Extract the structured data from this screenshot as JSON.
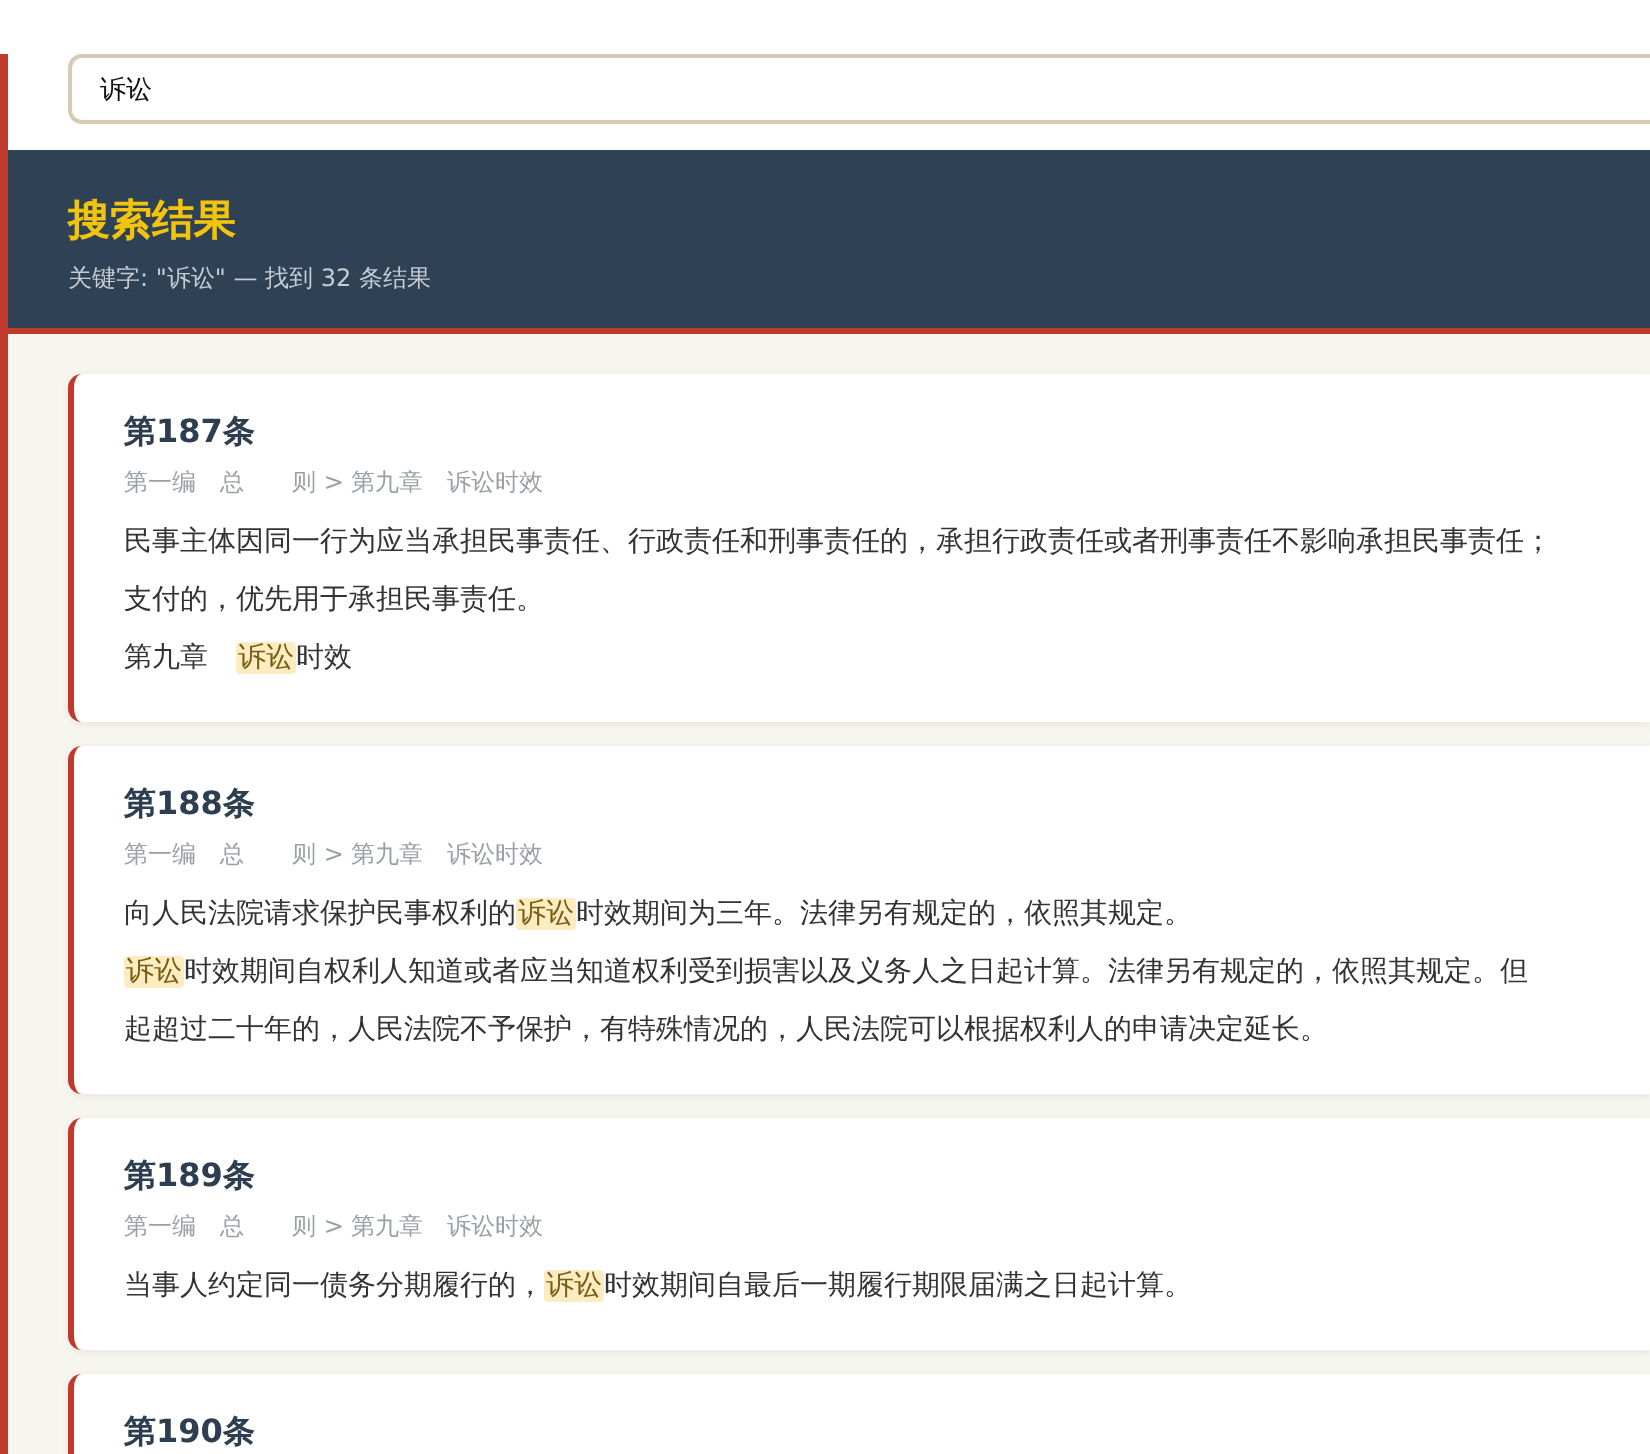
{
  "search": {
    "value": "诉讼"
  },
  "header": {
    "title": "搜索结果",
    "summary": "关键字: \"诉讼\" — 找到 32 条结果"
  },
  "results": [
    {
      "title": "第187条",
      "breadcrumb": "第一编　总　　则 > 第九章　诉讼时效",
      "lines": [
        [
          {
            "text": "民事主体因同一行为应当承担民事责任、行政责任和刑事责任的，承担行政责任或者刑事责任不影响承担民事责任；",
            "highlight": false
          }
        ],
        [
          {
            "text": "支付的，优先用于承担民事责任。",
            "highlight": false
          }
        ],
        [
          {
            "text": "第九章　",
            "highlight": false
          },
          {
            "text": "诉讼",
            "highlight": true
          },
          {
            "text": "时效",
            "highlight": false
          }
        ]
      ]
    },
    {
      "title": "第188条",
      "breadcrumb": "第一编　总　　则 > 第九章　诉讼时效",
      "lines": [
        [
          {
            "text": "向人民法院请求保护民事权利的",
            "highlight": false
          },
          {
            "text": "诉讼",
            "highlight": true
          },
          {
            "text": "时效期间为三年。法律另有规定的，依照其规定。",
            "highlight": false
          }
        ],
        [
          {
            "text": "诉讼",
            "highlight": true
          },
          {
            "text": "时效期间自权利人知道或者应当知道权利受到损害以及义务人之日起计算。法律另有规定的，依照其规定。但",
            "highlight": false
          }
        ],
        [
          {
            "text": "起超过二十年的，人民法院不予保护，有特殊情况的，人民法院可以根据权利人的申请决定延长。",
            "highlight": false
          }
        ]
      ]
    },
    {
      "title": "第189条",
      "breadcrumb": "第一编　总　　则 > 第九章　诉讼时效",
      "lines": [
        [
          {
            "text": "当事人约定同一债务分期履行的，",
            "highlight": false
          },
          {
            "text": "诉讼",
            "highlight": true
          },
          {
            "text": "时效期间自最后一期履行期限届满之日起计算。",
            "highlight": false
          }
        ]
      ]
    },
    {
      "title": "第190条"
    }
  ]
}
